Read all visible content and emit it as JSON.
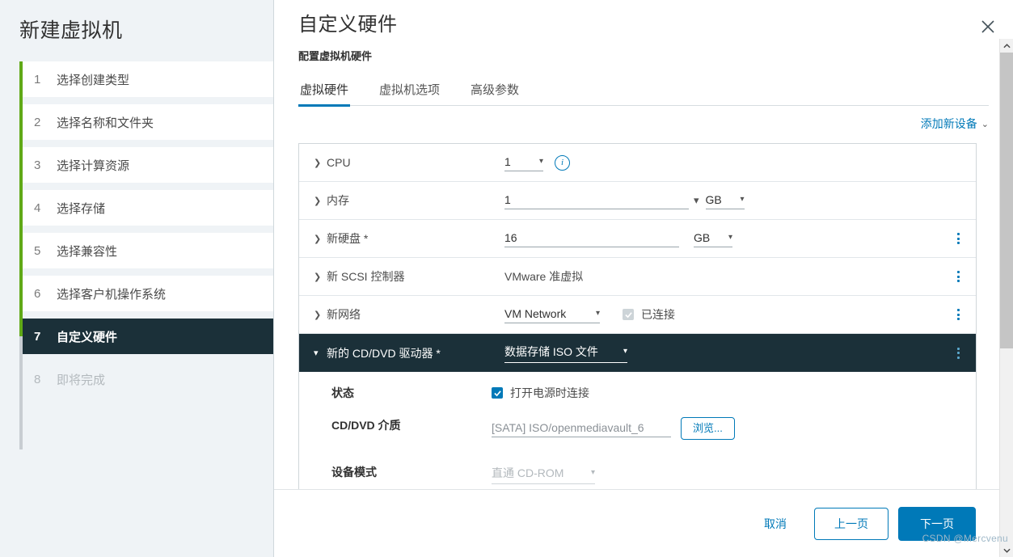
{
  "wizard": {
    "title": "新建虚拟机",
    "steps": [
      {
        "num": "1",
        "label": "选择创建类型",
        "state": "done"
      },
      {
        "num": "2",
        "label": "选择名称和文件夹",
        "state": "done"
      },
      {
        "num": "3",
        "label": "选择计算资源",
        "state": "done"
      },
      {
        "num": "4",
        "label": "选择存储",
        "state": "done"
      },
      {
        "num": "5",
        "label": "选择兼容性",
        "state": "done"
      },
      {
        "num": "6",
        "label": "选择客户机操作系统",
        "state": "done"
      },
      {
        "num": "7",
        "label": "自定义硬件",
        "state": "active"
      },
      {
        "num": "8",
        "label": "即将完成",
        "state": "future"
      }
    ]
  },
  "header": {
    "title": "自定义硬件",
    "subtitle": "配置虚拟机硬件",
    "close_icon": "close-icon"
  },
  "tabs": [
    {
      "label": "虚拟硬件",
      "active": true
    },
    {
      "label": "虚拟机选项",
      "active": false
    },
    {
      "label": "高级参数",
      "active": false
    }
  ],
  "toolbar": {
    "add_device_label": "添加新设备",
    "add_device_chevron": "⌄"
  },
  "hardware": {
    "rows": [
      {
        "key": "cpu",
        "label": "CPU",
        "value": "1",
        "info_icon": "info-icon",
        "caret": "collapsed"
      },
      {
        "key": "memory",
        "label": "内存",
        "value": "1",
        "unit": "GB",
        "caret": "collapsed"
      },
      {
        "key": "new-hard-disk",
        "label": "新硬盘 *",
        "value": "16",
        "unit": "GB",
        "caret": "collapsed"
      },
      {
        "key": "new-scsi-controller",
        "label": "新 SCSI 控制器",
        "value": "VMware 准虚拟",
        "caret": "collapsed"
      },
      {
        "key": "new-network",
        "label": "新网络",
        "value": "VM Network",
        "checkbox_label": "已连接",
        "checkbox_checked": true,
        "checkbox_disabled": true,
        "caret": "collapsed"
      }
    ],
    "cdrom": {
      "label": "新的 CD/DVD 驱动器 *",
      "type_value": "数据存储 ISO 文件",
      "caret": "expanded",
      "fields": [
        {
          "key": "status",
          "label": "状态",
          "checkbox_label": "打开电源时连接",
          "checked": true
        },
        {
          "key": "cd-media",
          "label": "CD/DVD 介质",
          "value": "[SATA] ISO/openmediavault_6",
          "button_label": "浏览..."
        },
        {
          "key": "device-mode",
          "label": "设备模式",
          "value": "直通 CD-ROM",
          "disabled": true
        }
      ]
    }
  },
  "footer": {
    "cancel_label": "取消",
    "back_label": "上一页",
    "next_label": "下一页"
  },
  "scrollbar": {
    "up_arrow": "⌃",
    "down_arrow": "⌄"
  },
  "watermark": "CSDN @Mercvenu",
  "colors": {
    "accent": "#0079b8",
    "active_step_bg": "#1b3039",
    "progress_rail": "#60a917",
    "sidebar_bg": "#eff3f6"
  }
}
